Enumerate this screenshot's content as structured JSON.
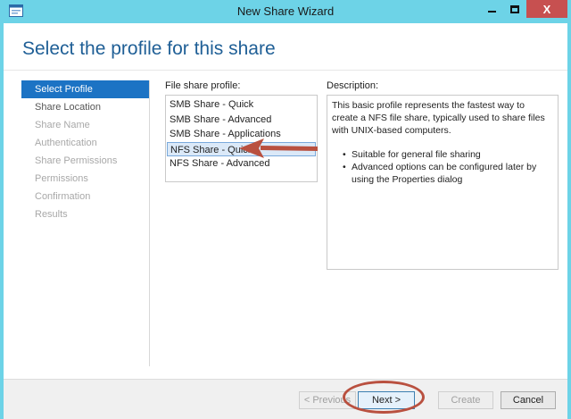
{
  "window": {
    "title": "New Share Wizard",
    "accent_color": "#6dd3e7",
    "close_color": "#c75050",
    "icons": {
      "app": "wizard-app-icon",
      "minimize": "minimize-icon",
      "maximize": "maximize-icon",
      "close": "close-icon"
    },
    "close_glyph": "X"
  },
  "page": {
    "title": "Select the profile for this share",
    "title_color": "#1f5f96"
  },
  "nav": {
    "active_color": "#1c73c4",
    "items": [
      {
        "label": "Select Profile",
        "state": "active"
      },
      {
        "label": "Share Location",
        "state": "enabled"
      },
      {
        "label": "Share Name",
        "state": "disabled"
      },
      {
        "label": "Authentication",
        "state": "disabled"
      },
      {
        "label": "Share Permissions",
        "state": "disabled"
      },
      {
        "label": "Permissions",
        "state": "disabled"
      },
      {
        "label": "Confirmation",
        "state": "disabled"
      },
      {
        "label": "Results",
        "state": "disabled"
      }
    ]
  },
  "profiles": {
    "label": "File share profile:",
    "items": [
      "SMB Share - Quick",
      "SMB Share - Advanced",
      "SMB Share - Applications",
      "NFS Share - Quick",
      "NFS Share - Advanced"
    ],
    "selected": "NFS Share - Quick"
  },
  "description": {
    "label": "Description:",
    "text": "This basic profile represents the fastest way to create a NFS file share, typically used to share files with UNIX-based computers.",
    "bullets": [
      "Suitable for general file sharing",
      "Advanced options can be configured later by using the Properties dialog"
    ]
  },
  "annotations": {
    "arrow_color": "#b9503f",
    "arrow_icon": "red-arrow-annotation",
    "ring_icon": "red-circle-annotation"
  },
  "footer": {
    "previous": "< Previous",
    "next": "Next >",
    "create": "Create",
    "cancel": "Cancel"
  }
}
